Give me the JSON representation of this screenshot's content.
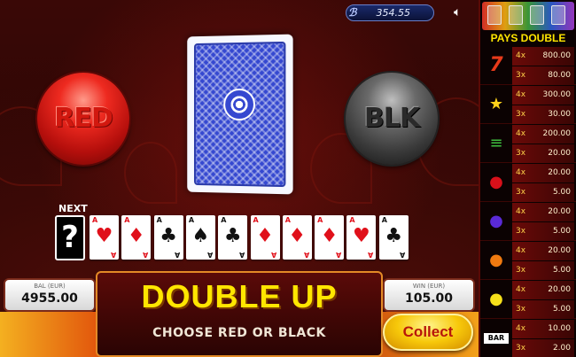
{
  "top_bar": {
    "credit_value": "354.55",
    "credit_icon": "coin-stack-icon",
    "sound_icon": "speaker-icon"
  },
  "buttons": {
    "red_label": "RED",
    "black_label": "BLK",
    "collect_label": "Collect"
  },
  "history": {
    "next_label": "NEXT",
    "next_symbol": "?",
    "cards": [
      {
        "rank": "A",
        "suit": "♥",
        "color": "#e0101a"
      },
      {
        "rank": "A",
        "suit": "♦",
        "color": "#e0101a"
      },
      {
        "rank": "A",
        "suit": "♣",
        "color": "#111111"
      },
      {
        "rank": "A",
        "suit": "♠",
        "color": "#111111"
      },
      {
        "rank": "A",
        "suit": "♣",
        "color": "#111111"
      },
      {
        "rank": "A",
        "suit": "♦",
        "color": "#e0101a"
      },
      {
        "rank": "A",
        "suit": "♦",
        "color": "#e0101a"
      },
      {
        "rank": "A",
        "suit": "♦",
        "color": "#e0101a"
      },
      {
        "rank": "A",
        "suit": "♥",
        "color": "#e0101a"
      },
      {
        "rank": "A",
        "suit": "♣",
        "color": "#111111"
      }
    ]
  },
  "balance": {
    "label": "BAL (EUR)",
    "value": "4955.00"
  },
  "win": {
    "label": "WIN (EUR)",
    "value": "105.00"
  },
  "double_up": {
    "title": "DOUBLE UP",
    "subtitle": "CHOOSE RED OR BLACK"
  },
  "paytable": {
    "title": "PAYS DOUBLE",
    "rows": [
      {
        "symbol": "seven-icon",
        "glyph": "7",
        "color": "#e83a1a",
        "lines": [
          {
            "mult": "4x",
            "pay": "800.00"
          },
          {
            "mult": "3x",
            "pay": "80.00"
          }
        ]
      },
      {
        "symbol": "star-icon",
        "glyph": "★",
        "color": "#ffd21a",
        "lines": [
          {
            "mult": "4x",
            "pay": "300.00"
          },
          {
            "mult": "3x",
            "pay": "30.00"
          }
        ]
      },
      {
        "symbol": "bar-stack-icon",
        "glyph": "≡",
        "color": "#3fbf3f",
        "lines": [
          {
            "mult": "4x",
            "pay": "200.00"
          },
          {
            "mult": "3x",
            "pay": "20.00"
          }
        ]
      },
      {
        "symbol": "cherry-icon",
        "glyph": "●",
        "color": "#d8101a",
        "lines": [
          {
            "mult": "4x",
            "pay": "20.00"
          },
          {
            "mult": "3x",
            "pay": "5.00"
          }
        ]
      },
      {
        "symbol": "plum-icon",
        "glyph": "●",
        "color": "#5a2ad6",
        "lines": [
          {
            "mult": "4x",
            "pay": "20.00"
          },
          {
            "mult": "3x",
            "pay": "5.00"
          }
        ]
      },
      {
        "symbol": "orange-icon",
        "glyph": "●",
        "color": "#f07a10",
        "lines": [
          {
            "mult": "4x",
            "pay": "20.00"
          },
          {
            "mult": "3x",
            "pay": "5.00"
          }
        ]
      },
      {
        "symbol": "lemon-icon",
        "glyph": "●",
        "color": "#f6e01a",
        "lines": [
          {
            "mult": "4x",
            "pay": "20.00"
          },
          {
            "mult": "3x",
            "pay": "5.00"
          }
        ]
      },
      {
        "symbol": "bar-icon",
        "glyph": "BAR",
        "color": "#dddddd",
        "lines": [
          {
            "mult": "4x",
            "pay": "10.00"
          },
          {
            "mult": "3x",
            "pay": "2.00"
          }
        ]
      }
    ]
  }
}
